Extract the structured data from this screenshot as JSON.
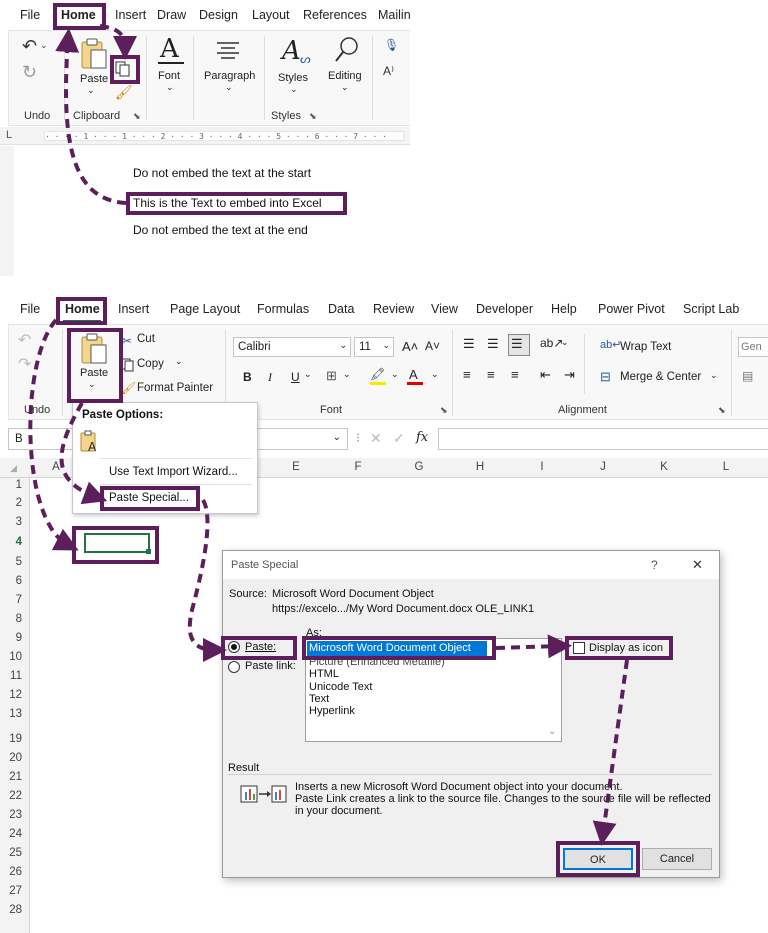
{
  "word": {
    "tabs": [
      "File",
      "Home",
      "Insert",
      "Draw",
      "Design",
      "Layout",
      "References",
      "Mailin"
    ],
    "undo_label": "Undo",
    "clipboard_label": "Clipboard",
    "paste_label": "Paste",
    "font_label": "Font",
    "paragraph_label": "Paragraph",
    "styles_label": "Styles",
    "styles_group_label": "Styles",
    "editing_label": "Editing",
    "doc_lines": [
      "Do not embed the text at the start",
      "This is the Text to embed into Excel",
      "Do not embed the text at the end"
    ]
  },
  "excel": {
    "tabs": [
      "File",
      "Home",
      "Insert",
      "Page Layout",
      "Formulas",
      "Data",
      "Review",
      "View",
      "Developer",
      "Help",
      "Power Pivot",
      "Script Lab"
    ],
    "cut_label": "Cut",
    "copy_label": "Copy",
    "format_painter_label": "Format Painter",
    "paste_label": "Paste",
    "undo_label": "Undo",
    "font_name": "Calibri",
    "font_size": "11",
    "font_group_label": "Font",
    "alignment_group_label": "Alignment",
    "wrap_text_label": "Wrap Text",
    "merge_center_label": "Merge & Center",
    "number_format": "Gen",
    "namebox_value": "B",
    "fx_label": "fx",
    "columns": [
      "A",
      "E",
      "F",
      "G",
      "H",
      "I",
      "J",
      "K",
      "L"
    ],
    "rows": [
      "1",
      "2",
      "3",
      "4",
      "5",
      "6",
      "7",
      "8",
      "9",
      "10",
      "11",
      "12",
      "13",
      "19",
      "20",
      "21",
      "22",
      "23",
      "24",
      "25",
      "26",
      "27",
      "28"
    ],
    "paste_menu": {
      "title": "Paste Options:",
      "import_wizard": "Use Text Import Wizard...",
      "paste_special": "Paste Special..."
    }
  },
  "dialog": {
    "title": "Paste Special",
    "help": "?",
    "close": "✕",
    "source_label": "Source:",
    "source_value": "Microsoft Word Document Object",
    "source_path": "https://excelo.../My Word Document.docx OLE_LINK1",
    "as_label": "As:",
    "paste_option": "Paste:",
    "paste_link_option": "Paste link:",
    "list_items": [
      "Microsoft Word Document Object",
      "Picture (Enhanced Metafile)",
      "HTML",
      "Unicode Text",
      "Text",
      "Hyperlink"
    ],
    "display_as_icon": "Display as icon",
    "result_label": "Result",
    "result_line1": "Inserts a new Microsoft Word Document object into your document.",
    "result_line2": "Paste Link creates a link to the source file. Changes to the source file will be reflected",
    "result_line3": "in your document.",
    "ok_label": "OK",
    "cancel_label": "Cancel"
  },
  "accent_color": "#5c1f5c",
  "excel_green": "#217346"
}
